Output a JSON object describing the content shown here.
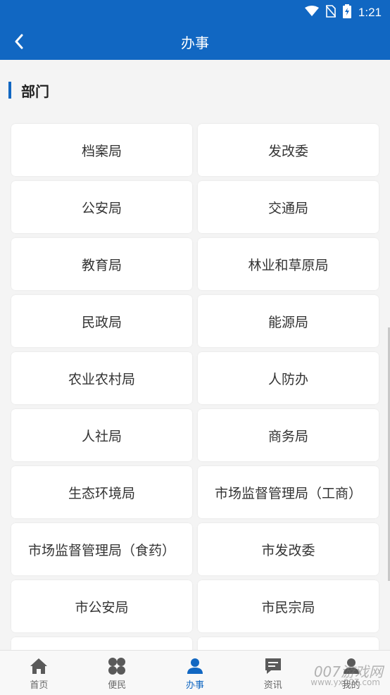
{
  "status_bar": {
    "time": "1:21"
  },
  "app_bar": {
    "title": "办事"
  },
  "section": {
    "title": "部门"
  },
  "departments": [
    "档案局",
    "发改委",
    "公安局",
    "交通局",
    "教育局",
    "林业和草原局",
    "民政局",
    "能源局",
    "农业农村局",
    "人防办",
    "人社局",
    "商务局",
    "生态环境局",
    "市场监督管理局（工商）",
    "市场监督管理局（食药）",
    "市发改委",
    "市公安局",
    "市民宗局"
  ],
  "bottom_nav": [
    {
      "label": "首页",
      "icon": "home-icon"
    },
    {
      "label": "便民",
      "icon": "grid-icon"
    },
    {
      "label": "办事",
      "icon": "person-icon",
      "active": true
    },
    {
      "label": "资讯",
      "icon": "message-icon"
    },
    {
      "label": "我的",
      "icon": "user-icon"
    }
  ],
  "watermark": {
    "text": "007游戏网",
    "sub": "www.yx007.com"
  },
  "colors": {
    "primary": "#1167c2",
    "background": "#f4f4f4"
  }
}
